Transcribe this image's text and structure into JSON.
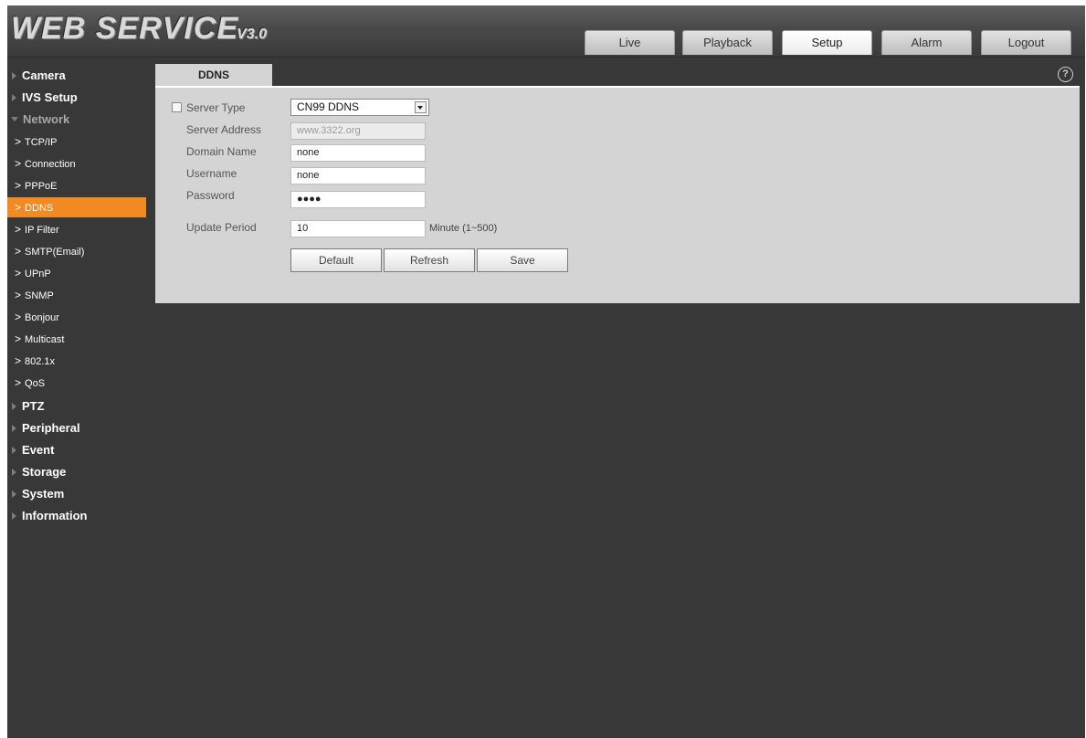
{
  "header": {
    "logo_main": "WEB SERVICE",
    "logo_version": "V3.0"
  },
  "nav": {
    "tabs": [
      {
        "label": "Live"
      },
      {
        "label": "Playback"
      },
      {
        "label": "Setup",
        "active": true
      },
      {
        "label": "Alarm"
      },
      {
        "label": "Logout"
      }
    ]
  },
  "sidebar": {
    "items": [
      {
        "label": "Camera",
        "type": "group"
      },
      {
        "label": "IVS Setup",
        "type": "group"
      },
      {
        "label": "Network",
        "type": "group",
        "expanded": true
      },
      {
        "label": "TCP/IP",
        "type": "sub"
      },
      {
        "label": "Connection",
        "type": "sub"
      },
      {
        "label": "PPPoE",
        "type": "sub"
      },
      {
        "label": "DDNS",
        "type": "sub",
        "active": true
      },
      {
        "label": "IP Filter",
        "type": "sub"
      },
      {
        "label": "SMTP(Email)",
        "type": "sub"
      },
      {
        "label": "UPnP",
        "type": "sub"
      },
      {
        "label": "SNMP",
        "type": "sub"
      },
      {
        "label": "Bonjour",
        "type": "sub"
      },
      {
        "label": "Multicast",
        "type": "sub"
      },
      {
        "label": "802.1x",
        "type": "sub"
      },
      {
        "label": "QoS",
        "type": "sub"
      },
      {
        "label": "PTZ",
        "type": "group"
      },
      {
        "label": "Peripheral",
        "type": "group"
      },
      {
        "label": "Event",
        "type": "group"
      },
      {
        "label": "Storage",
        "type": "group"
      },
      {
        "label": "System",
        "type": "group"
      },
      {
        "label": "Information",
        "type": "group"
      }
    ]
  },
  "panel": {
    "tab_label": "DDNS",
    "help_symbol": "?",
    "server_type": {
      "label": "Server Type",
      "checked": false,
      "value": "CN99 DDNS"
    },
    "server_address": {
      "label": "Server Address",
      "value": "www.3322.org"
    },
    "domain_name": {
      "label": "Domain Name",
      "value": "none"
    },
    "username": {
      "label": "Username",
      "value": "none"
    },
    "password": {
      "label": "Password",
      "value": "●●●●"
    },
    "update_period": {
      "label": "Update Period",
      "value": "10",
      "unit": "Minute (1~500)"
    },
    "buttons": {
      "default": "Default",
      "refresh": "Refresh",
      "save": "Save"
    }
  },
  "colors": {
    "background": "#383838",
    "panel": "#d4d4d4",
    "accent": "#f28a24"
  }
}
